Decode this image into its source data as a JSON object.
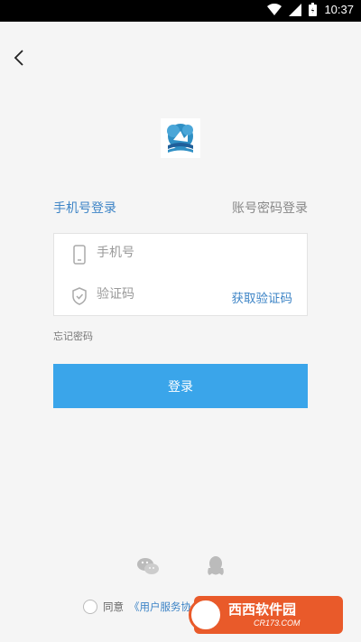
{
  "status_bar": {
    "time": "10:37",
    "icons": [
      "wifi-icon",
      "signal-icon",
      "battery-icon"
    ]
  },
  "header": {
    "back_icon": "chevron-left-icon"
  },
  "logo": {
    "icon": "app-logo"
  },
  "tabs": [
    {
      "label": "手机号登录",
      "active": true
    },
    {
      "label": "账号密码登录",
      "active": false
    }
  ],
  "form": {
    "phone_placeholder": "手机号",
    "code_placeholder": "验证码",
    "get_code_label": "获取验证码"
  },
  "forgot_password": "忘记密码",
  "login_button": "登录",
  "social": [
    "wechat-icon",
    "qq-icon"
  ],
  "agreement": {
    "prefix": "同意",
    "link": "《用户服务协"
  },
  "watermark": {
    "main": "西西软件园",
    "sub": "CR173.COM"
  },
  "colors": {
    "accent": "#3d84c6",
    "button": "#3aa5ea",
    "background": "#f5f5f5"
  }
}
